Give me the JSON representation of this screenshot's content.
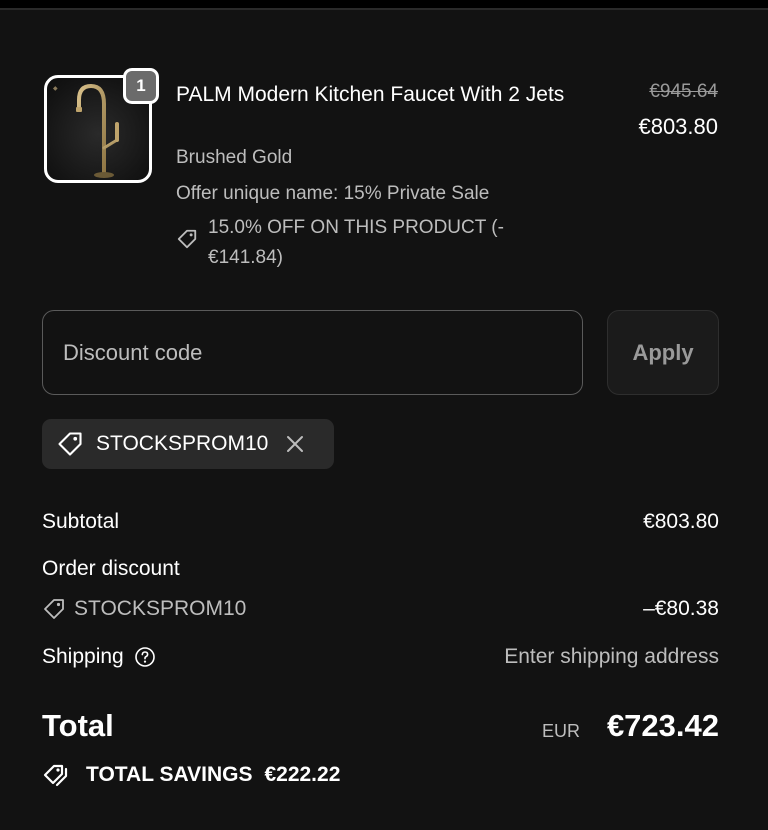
{
  "product": {
    "quantity": "1",
    "title": "PALM Modern Kitchen Faucet With 2 Jets",
    "variant": "Brushed Gold",
    "offer": "Offer unique name: 15% Private Sale",
    "discount_line": "15.0% OFF ON THIS PRODUCT (-€141.84)",
    "price_original": "€945.64",
    "price_current": "€803.80",
    "image_icon": "faucet-image"
  },
  "discount": {
    "placeholder": "Discount code",
    "apply_label": "Apply",
    "applied_code": "STOCKSPROM10"
  },
  "summary": {
    "subtotal_label": "Subtotal",
    "subtotal_value": "€803.80",
    "order_discount_label": "Order discount",
    "order_discount_code": "STOCKSPROM10",
    "order_discount_value": "–€80.38",
    "shipping_label": "Shipping",
    "shipping_value": "Enter shipping address",
    "total_label": "Total",
    "total_currency": "EUR",
    "total_value": "€723.42",
    "savings_label": "TOTAL SAVINGS",
    "savings_value": "€222.22"
  },
  "colors": {
    "background": "#121212",
    "text": "#ffffff",
    "muted_text": "#bdbdbd",
    "chip_bg": "#2a2a2a"
  }
}
